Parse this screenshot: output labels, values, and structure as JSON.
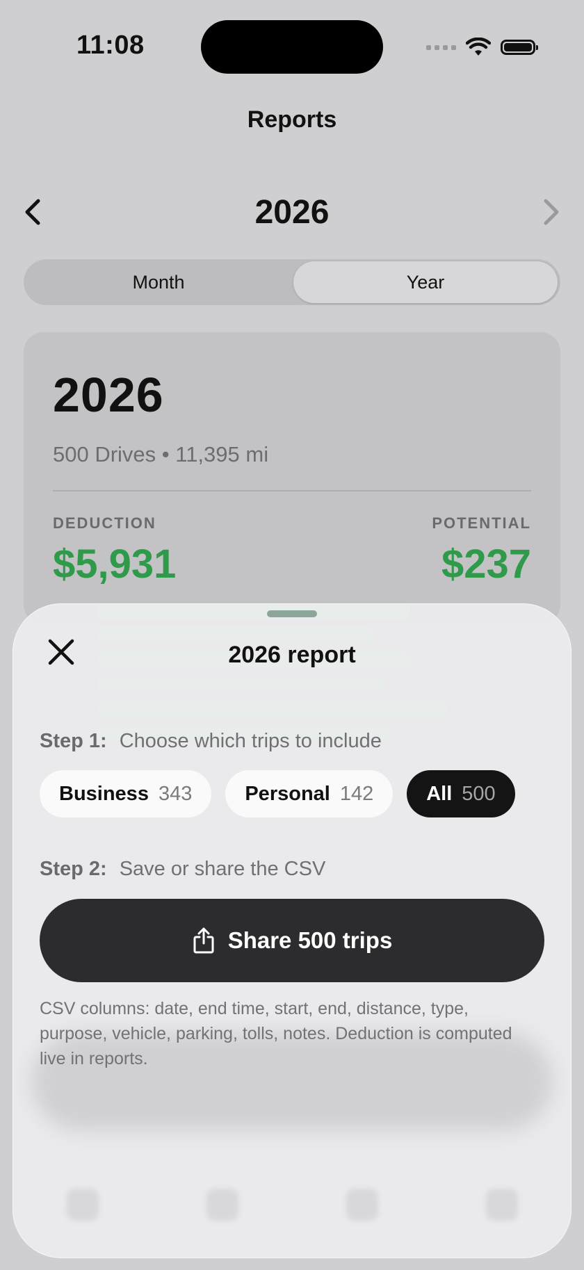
{
  "status": {
    "time": "11:08"
  },
  "nav": {
    "title": "Reports"
  },
  "period": {
    "year": "2026"
  },
  "segment": {
    "month": "Month",
    "year": "Year",
    "selected": "Year"
  },
  "summary": {
    "year": "2026",
    "subtitle": "500 Drives • 11,395 mi",
    "deduction_label": "DEDUCTION",
    "deduction_value": "$5,931",
    "potential_label": "POTENTIAL",
    "potential_value": "$237"
  },
  "sheet": {
    "title": "2026 report",
    "step1_label": "Step 1:",
    "step1_text": "Choose which trips to include",
    "filters": [
      {
        "name": "Business",
        "count": "343",
        "selected": false
      },
      {
        "name": "Personal",
        "count": "142",
        "selected": false
      },
      {
        "name": "All",
        "count": "500",
        "selected": true
      }
    ],
    "step2_label": "Step 2:",
    "step2_text": "Save or share the CSV",
    "share_label": "Share 500 trips",
    "footnote": "CSV columns: date, end time, start, end, distance, type, purpose, vehicle, parking, tolls, notes. Deduction is computed live in reports."
  },
  "colors": {
    "accent_green": "#2f9a49",
    "primary_button": "#2c2c2f",
    "chip_selected": "#141414"
  },
  "icons": [
    "wifi-icon",
    "battery-icon",
    "chevron-left-icon",
    "chevron-right-icon",
    "close-icon",
    "share-icon"
  ]
}
